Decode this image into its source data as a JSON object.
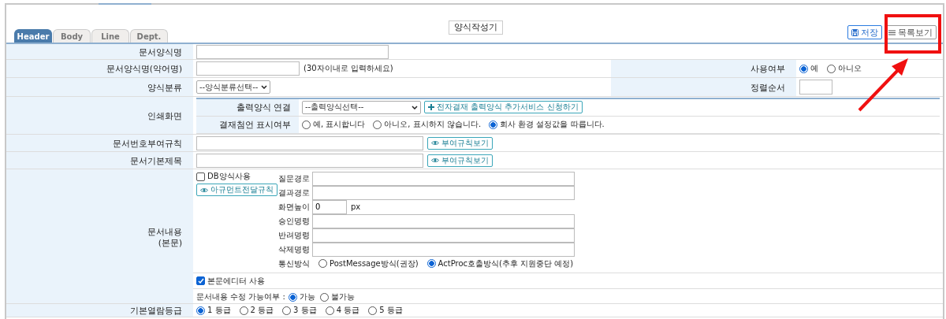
{
  "toolbar": {
    "title": "양식작성기",
    "save": "저장",
    "list": "목록보기"
  },
  "tabs": [
    {
      "label": "Header",
      "selected": true
    },
    {
      "label": "Body",
      "selected": false
    },
    {
      "label": "Line",
      "selected": false
    },
    {
      "label": "Dept.",
      "selected": false
    }
  ],
  "form_name": {
    "label": "문서양식명"
  },
  "short_name": {
    "label": "문서양식명(약어명)",
    "hint": "(30자이내로 입력하세요)",
    "use_label": "사용여부",
    "use_options": [
      {
        "label": "예",
        "selected": true
      },
      {
        "label": "아니오",
        "selected": false
      }
    ]
  },
  "category": {
    "label": "양식분류",
    "value": "--양식분류선택--",
    "order_label": "정렬순서"
  },
  "print": {
    "label": "인쇄화면",
    "link_label": "출력양식 연결",
    "link_value": "--출력양식선택--",
    "link_button": "전자결재 출력양식 추가서비스 신청하기",
    "comment_label": "결재첨언 표시여부",
    "comment_options": [
      {
        "label": "예, 표시합니다",
        "selected": false
      },
      {
        "label": "아니오, 표시하지 않습니다.",
        "selected": false
      },
      {
        "label": "회사 환경 설정값을 따릅니다.",
        "selected": true
      }
    ]
  },
  "number_rule": {
    "label": "문서번호부여규칙",
    "button": "부여규칙보기"
  },
  "default_title": {
    "label": "문서기본제목",
    "button": "부여규칙보기"
  },
  "content": {
    "label_lines": [
      "문서내용",
      "(본문)"
    ],
    "db_use": {
      "label": "DB양식사용",
      "checked": false
    },
    "arg_button": "아규먼트전달규칙",
    "fields": [
      {
        "label": "질문경로",
        "kind": "wide"
      },
      {
        "label": "결과경로",
        "kind": "wide"
      },
      {
        "label": "화면높이",
        "kind": "short",
        "value": "0",
        "unit": "px"
      },
      {
        "label": "승인명령",
        "kind": "wide"
      },
      {
        "label": "반려명령",
        "kind": "wide"
      },
      {
        "label": "삭제명령",
        "kind": "wide"
      }
    ],
    "comm_label": "통신방식",
    "comm_options": [
      {
        "label": "PostMessage방식(권장)",
        "selected": false
      },
      {
        "label": "ActProc호출방식(추후 지원중단 예정)",
        "selected": true
      }
    ],
    "editor": {
      "label": "본문에디터 사용",
      "checked": true
    },
    "editable_label": "문서내용 수정 가능여부 :",
    "editable_options": [
      {
        "label": "가능",
        "selected": true
      },
      {
        "label": "불가능",
        "selected": false
      }
    ]
  },
  "read_level": {
    "label": "기본열람등급",
    "options": [
      {
        "label": "1 등급",
        "selected": true
      },
      {
        "label": "2 등급",
        "selected": false
      },
      {
        "label": "3 등급",
        "selected": false
      },
      {
        "label": "4 등급",
        "selected": false
      },
      {
        "label": "5 등급",
        "selected": false
      }
    ]
  },
  "annotations": {
    "highlight_box": true,
    "arrow": true
  }
}
